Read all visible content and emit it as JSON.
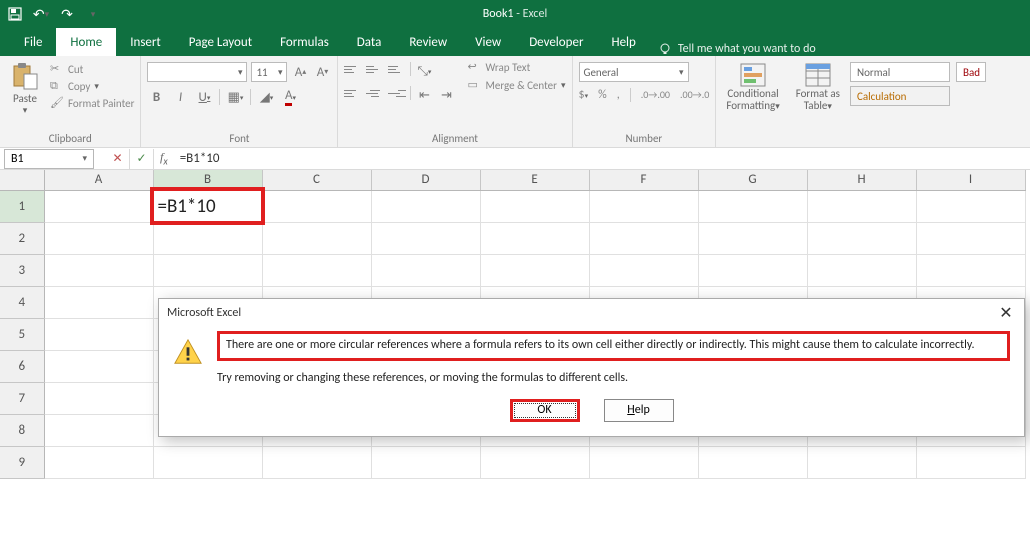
{
  "title": {
    "doc": "Book1",
    "app": "Excel"
  },
  "qat": {
    "save": "save-icon",
    "undo": "undo-icon",
    "redo": "redo-icon"
  },
  "tabs": [
    "File",
    "Home",
    "Insert",
    "Page Layout",
    "Formulas",
    "Data",
    "Review",
    "View",
    "Developer",
    "Help"
  ],
  "active_tab": "Home",
  "tell_me": "Tell me what you want to do",
  "ribbon": {
    "clipboard": {
      "label": "Clipboard",
      "paste": "Paste",
      "cut": "Cut",
      "copy": "Copy",
      "format_painter": "Format Painter"
    },
    "font": {
      "label": "Font",
      "name_placeholder": "",
      "size": "11",
      "bold": "B",
      "italic": "I",
      "underline": "U"
    },
    "alignment": {
      "label": "Alignment",
      "wrap": "Wrap Text",
      "merge": "Merge & Center"
    },
    "number": {
      "label": "Number",
      "format": "General"
    },
    "styles": {
      "conditional": "Conditional Formatting",
      "format_table": "Format as Table",
      "normal": "Normal",
      "bad": "Bad",
      "calculation": "Calculation"
    }
  },
  "namebox": "B1",
  "formula": "=B1*10",
  "columns": [
    "A",
    "B",
    "C",
    "D",
    "E",
    "F",
    "G",
    "H",
    "I"
  ],
  "rows": [
    "1",
    "2",
    "3",
    "4",
    "5",
    "6",
    "7",
    "8",
    "9"
  ],
  "active_cell": {
    "col": "B",
    "row": "1",
    "value": "=B1*10"
  },
  "dialog": {
    "title": "Microsoft Excel",
    "msg1": "There are one or more circular references where a formula refers to its own cell either directly or indirectly. This might cause them to calculate incorrectly.",
    "msg2": "Try removing or changing these references, or moving the formulas to different cells.",
    "ok": "OK",
    "help": "Help",
    "help_prefix": "H",
    "help_rest": "elp"
  }
}
